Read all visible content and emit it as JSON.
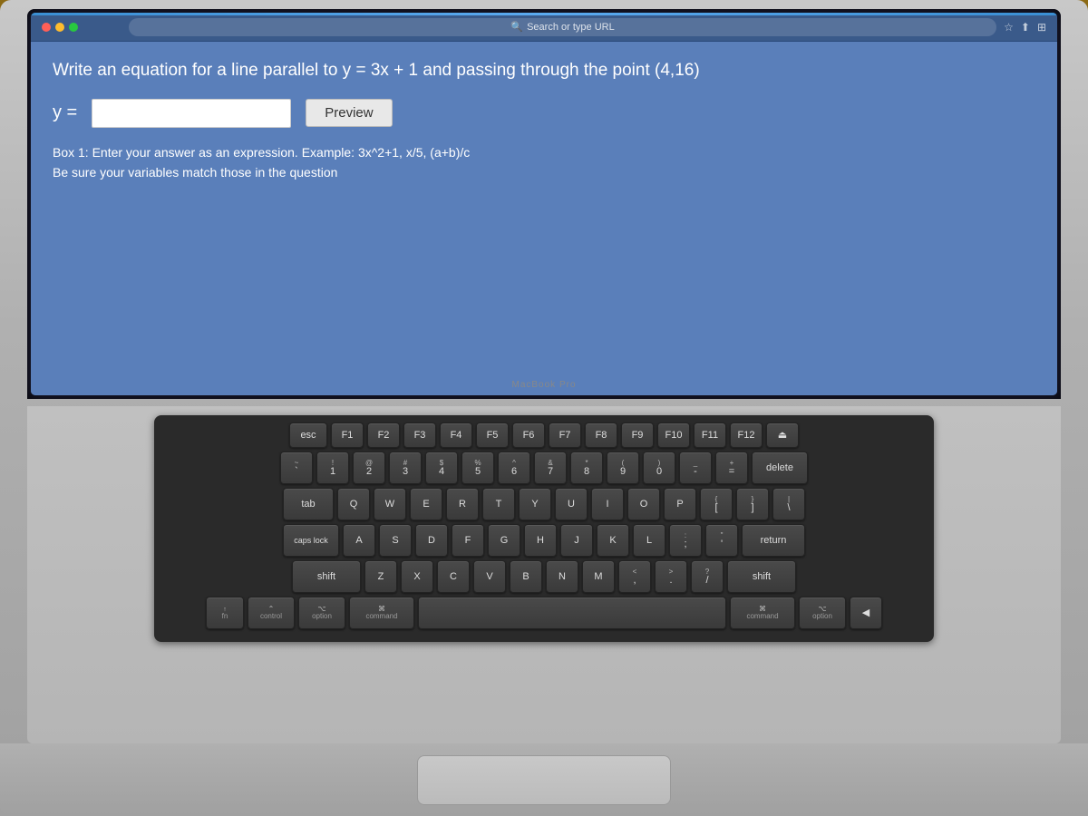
{
  "screen": {
    "question": "Write an equation for a line parallel to y = 3x + 1 and passing through the point (4,16)",
    "y_equals": "y =",
    "preview_button": "Preview",
    "instructions_line1": "Box 1: Enter your answer as an expression. Example: 3x^2+1, x/5, (a+b)/c",
    "instructions_line2": "Be sure your variables match those in the question",
    "macbook_label": "MacBook Pro",
    "url_bar_text": "Search or type URL"
  },
  "keyboard": {
    "rows": [
      {
        "id": "fn-row",
        "keys": [
          {
            "label": "esc",
            "size": "esc"
          },
          {
            "label": "F1",
            "size": "sm"
          },
          {
            "label": "F2",
            "size": "sm"
          },
          {
            "label": "F3",
            "size": "sm"
          },
          {
            "label": "F4",
            "size": "sm"
          },
          {
            "label": "F5",
            "size": "sm"
          },
          {
            "label": "F6",
            "size": "sm"
          },
          {
            "label": "F7",
            "size": "sm"
          },
          {
            "label": "F8",
            "size": "sm"
          },
          {
            "label": "F9",
            "size": "sm"
          },
          {
            "label": "F10",
            "size": "sm"
          },
          {
            "label": "F11",
            "size": "sm"
          },
          {
            "label": "F12",
            "size": "sm"
          },
          {
            "label": "⏏",
            "size": "sm"
          }
        ]
      }
    ],
    "bottom_row": {
      "fn": "fn",
      "ctrl": "control",
      "option_l": "option",
      "cmd_l": "command",
      "space": "",
      "cmd_r": "command",
      "option_r": "option",
      "arrow_left": "◀"
    }
  }
}
